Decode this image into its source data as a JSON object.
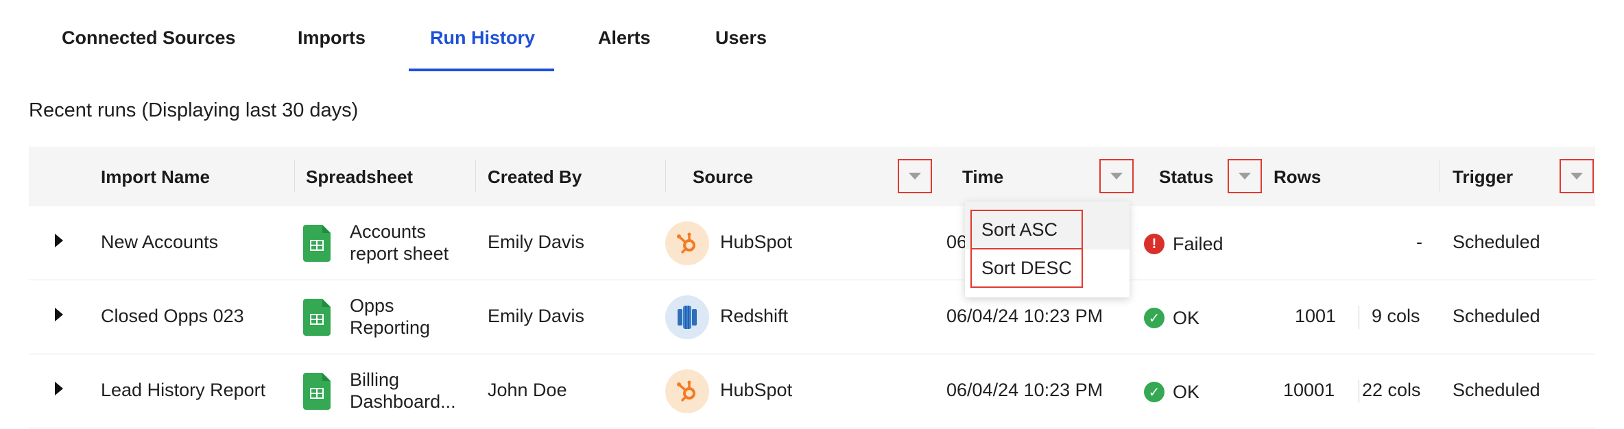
{
  "tabs": [
    {
      "label": "Connected Sources",
      "active": false
    },
    {
      "label": "Imports",
      "active": false
    },
    {
      "label": "Run History",
      "active": true
    },
    {
      "label": "Alerts",
      "active": false
    },
    {
      "label": "Users",
      "active": false
    }
  ],
  "section_title": "Recent runs (Displaying last 30 days)",
  "columns": {
    "import_name": "Import Name",
    "spreadsheet": "Spreadsheet",
    "created_by": "Created By",
    "source": "Source",
    "time": "Time",
    "status": "Status",
    "rows": "Rows",
    "trigger": "Trigger"
  },
  "rows": [
    {
      "import_name": "New Accounts",
      "spreadsheet_line1": "Accounts",
      "spreadsheet_line2": "report sheet",
      "created_by": "Emily Davis",
      "source": "HubSpot",
      "source_icon": "hubspot-icon",
      "time": "06",
      "status": "Failed",
      "status_icon": "error-icon",
      "rows": "-",
      "cols": "",
      "trigger": "Scheduled"
    },
    {
      "import_name": "Closed Opps 023",
      "spreadsheet_line1": "Opps",
      "spreadsheet_line2": "Reporting",
      "created_by": "Emily Davis",
      "source": "Redshift",
      "source_icon": "redshift-icon",
      "time": "06/04/24 10:23 PM",
      "status": "OK",
      "status_icon": "check-icon",
      "rows": "1001",
      "cols": "9 cols",
      "trigger": "Scheduled"
    },
    {
      "import_name": "Lead History Report",
      "spreadsheet_line1": "Billing",
      "spreadsheet_line2": "Dashboard...",
      "created_by": "John Doe",
      "source": "HubSpot",
      "source_icon": "hubspot-icon",
      "time": "06/04/24 10:23 PM",
      "status": "OK",
      "status_icon": "check-icon",
      "rows": "10001",
      "cols": "22 cols",
      "trigger": "Scheduled"
    }
  ],
  "sort_menu": {
    "asc_label": "Sort ASC",
    "desc_label": "Sort DESC"
  },
  "colors": {
    "accent": "#1d4fd8",
    "highlight_border": "#e03a2f",
    "failed": "#d9302c",
    "ok": "#34a853",
    "sheets_green": "#34a853",
    "hubspot_orange": "#f57b23"
  }
}
